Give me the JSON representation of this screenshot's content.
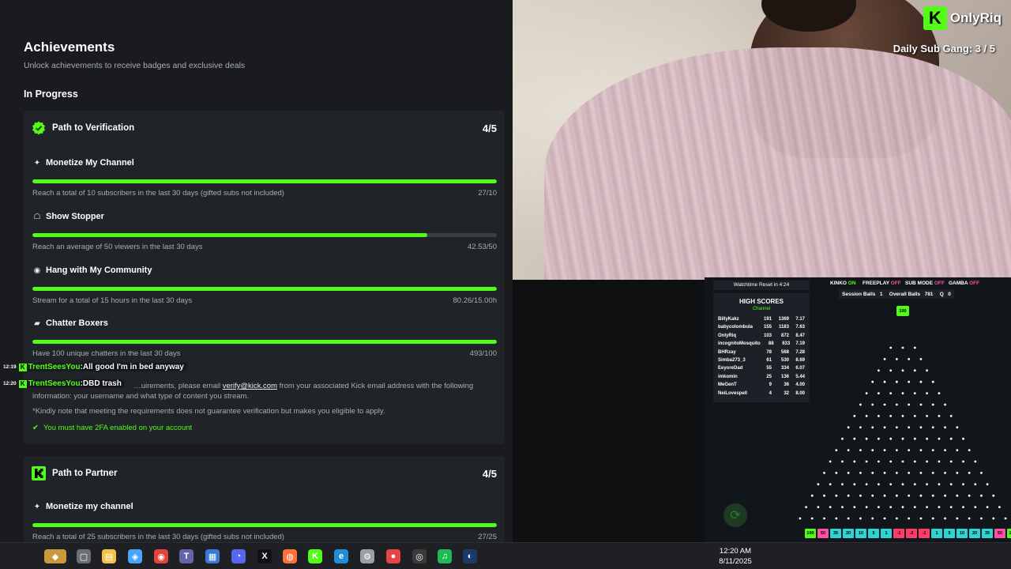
{
  "achievements": {
    "title": "Achievements",
    "subtitle": "Unlock achievements to receive badges and exclusive deals",
    "section": "In Progress",
    "verification": {
      "title": "Path to Verification",
      "count": "4/5",
      "tasks": [
        {
          "name": "Monetize My Channel",
          "desc": "Reach a total of 10 subscribers in the last 30 days (gifted subs not included)",
          "value": "27/10",
          "progress": 1.0
        },
        {
          "name": "Show Stopper",
          "desc": "Reach an average of 50 viewers in the last 30 days",
          "value": "42.53/50",
          "progress": 0.85
        },
        {
          "name": "Hang with My Community",
          "desc": "Stream for a total of 15 hours in the last 30 days",
          "value": "80.26/15.00h",
          "progress": 1.0
        },
        {
          "name": "Chatter Boxers",
          "desc": "Have 100 unique chatters in the last 30 days",
          "value": "493/100",
          "progress": 1.0
        }
      ],
      "note_prefix": "…uirements, please email",
      "note_email": "verify@kick.com",
      "note_suffix": "from your associated Kick email address with the following",
      "note_line2": "information: your username and what type of content you stream.",
      "note_line3": "*Kindly note that meeting the requirements does not guarantee verification but makes you eligible to apply.",
      "requirement": "You must have 2FA enabled on your account"
    },
    "partner": {
      "title": "Path to Partner",
      "count": "4/5",
      "tasks": [
        {
          "name": "Monetize my channel",
          "desc": "Reach a total of 25 subscribers in the last 30 days (gifted subs not included)",
          "value": "27/25",
          "progress": 1.0
        }
      ]
    }
  },
  "chat": [
    {
      "time": "12:19",
      "user": "TrentSeesYou",
      "message": "All good I'm in bed anyway"
    },
    {
      "time": "12:20",
      "user": "TrentSeesYou",
      "message": "DBD trash"
    }
  ],
  "stream": {
    "brand": "OnlyRiq",
    "brand_mark": "K",
    "daily_sub": "Daily Sub Gang:  3 / 5"
  },
  "plinko": {
    "watchtime": "Watchtime Reset in 4:24",
    "high_scores_title": "HIGH SCORES",
    "high_scores_sub": "Channel",
    "scores": [
      {
        "name": "BillyKakz",
        "a": "191",
        "b": "1369",
        "c": "7.17"
      },
      {
        "name": "babycolombula",
        "a": "155",
        "b": "1183",
        "c": "7.63"
      },
      {
        "name": "OnlyRiq",
        "a": "103",
        "b": "872",
        "c": "8.47"
      },
      {
        "name": "incognitoMosquito",
        "a": "88",
        "b": "633",
        "c": "7.19"
      },
      {
        "name": "BHRzay",
        "a": "78",
        "b": "568",
        "c": "7.28"
      },
      {
        "name": "Simba273_3",
        "a": "61",
        "b": "530",
        "c": "8.69"
      },
      {
        "name": "EeyoreDad",
        "a": "55",
        "b": "334",
        "c": "6.07"
      },
      {
        "name": "imkomin",
        "a": "25",
        "b": "136",
        "c": "5.44"
      },
      {
        "name": "MeGenT",
        "a": "9",
        "b": "36",
        "c": "4.00"
      },
      {
        "name": "NeiLovespell",
        "a": "4",
        "b": "32",
        "c": "8.00"
      }
    ],
    "modes": [
      {
        "label": "KINKO",
        "state": "ON"
      },
      {
        "label": "FREEPLAY",
        "state": "OFF"
      },
      {
        "label": "SUB MODE",
        "state": "OFF"
      },
      {
        "label": "GAMBA",
        "state": "OFF"
      }
    ],
    "session_balls_label": "Session Balls",
    "session_balls": "1",
    "overall_balls_label": "Overall Balls",
    "overall_balls": "781",
    "q_label": "Q",
    "q_value": "0",
    "ball_value": "100",
    "slots": [
      {
        "v": "100",
        "c": "#53fc18"
      },
      {
        "v": "50",
        "c": "#ff4fa3"
      },
      {
        "v": "35",
        "c": "#2ed3d3"
      },
      {
        "v": "20",
        "c": "#2ed3d3"
      },
      {
        "v": "10",
        "c": "#2ed3d3"
      },
      {
        "v": "5",
        "c": "#2ed3d3"
      },
      {
        "v": "1",
        "c": "#2ed3d3"
      },
      {
        "v": "-1",
        "c": "#ff3b6b"
      },
      {
        "v": "-2",
        "c": "#ff3b6b"
      },
      {
        "v": "-1",
        "c": "#ff3b6b"
      },
      {
        "v": "1",
        "c": "#2ed3d3"
      },
      {
        "v": "5",
        "c": "#2ed3d3"
      },
      {
        "v": "10",
        "c": "#2ed3d3"
      },
      {
        "v": "20",
        "c": "#2ed3d3"
      },
      {
        "v": "35",
        "c": "#2ed3d3"
      },
      {
        "v": "50",
        "c": "#ff4fa3"
      },
      {
        "v": "100",
        "c": "#53fc18"
      }
    ]
  },
  "taskbar": {
    "time": "12:20 AM",
    "date": "8/11/2025",
    "icons": [
      "widgets-icon",
      "task-view-icon",
      "file-explorer-icon",
      "copilot-icon",
      "chrome-icon",
      "teams-icon",
      "store-icon",
      "discord-icon",
      "x-icon",
      "firefox-icon",
      "kick-icon",
      "edge-icon",
      "settings-icon",
      "maps-icon",
      "obs-icon",
      "spotify-icon",
      "steam-icon"
    ]
  },
  "colors": {
    "accent": "#53fc18",
    "panel": "#191b1f",
    "card": "#202328"
  }
}
